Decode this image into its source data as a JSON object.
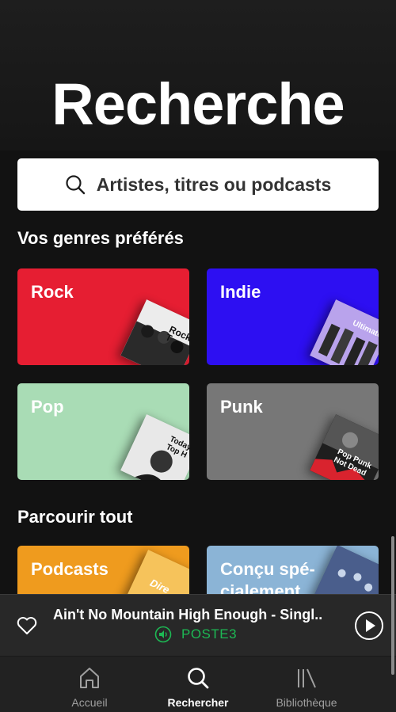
{
  "header": {
    "title": "Recherche"
  },
  "search": {
    "placeholder": "Artistes, titres ou podcasts"
  },
  "sections": {
    "favorites_title": "Vos genres préférés",
    "browse_title": "Parcourir tout"
  },
  "genres": [
    {
      "label": "Rock",
      "color": "#e61e32",
      "cover_text": "Rock T",
      "cover_color": "#ececec"
    },
    {
      "label": "Indie",
      "color": "#2d0ff2",
      "cover_text": "Ultimate I",
      "cover_color": "#9a7bd8"
    },
    {
      "label": "Pop",
      "color": "#a9dcb5",
      "cover_text": "Today's Top H",
      "cover_color": "#e8e8e8"
    },
    {
      "label": "Punk",
      "color": "#777777",
      "cover_text": "Pop Punk Not Dead",
      "cover_color": "#1e1e1e"
    }
  ],
  "browse": [
    {
      "label": "Podcasts",
      "color": "#ef9b1e",
      "cover_text": "Dire",
      "cover_color": "#f6c35b"
    },
    {
      "label": "Conçu spé-cialement",
      "color": "#8bb4d6",
      "cover_text": "",
      "cover_color": "#3b4f7d"
    }
  ],
  "player": {
    "track": "Ain't No Mountain High Enough - Singl..",
    "device": "POSTE3",
    "accent": "#1db954"
  },
  "tabs": [
    {
      "label": "Accueil",
      "icon": "home-icon"
    },
    {
      "label": "Rechercher",
      "icon": "search-icon",
      "active": true
    },
    {
      "label": "Bibliothèque",
      "icon": "library-icon"
    }
  ]
}
